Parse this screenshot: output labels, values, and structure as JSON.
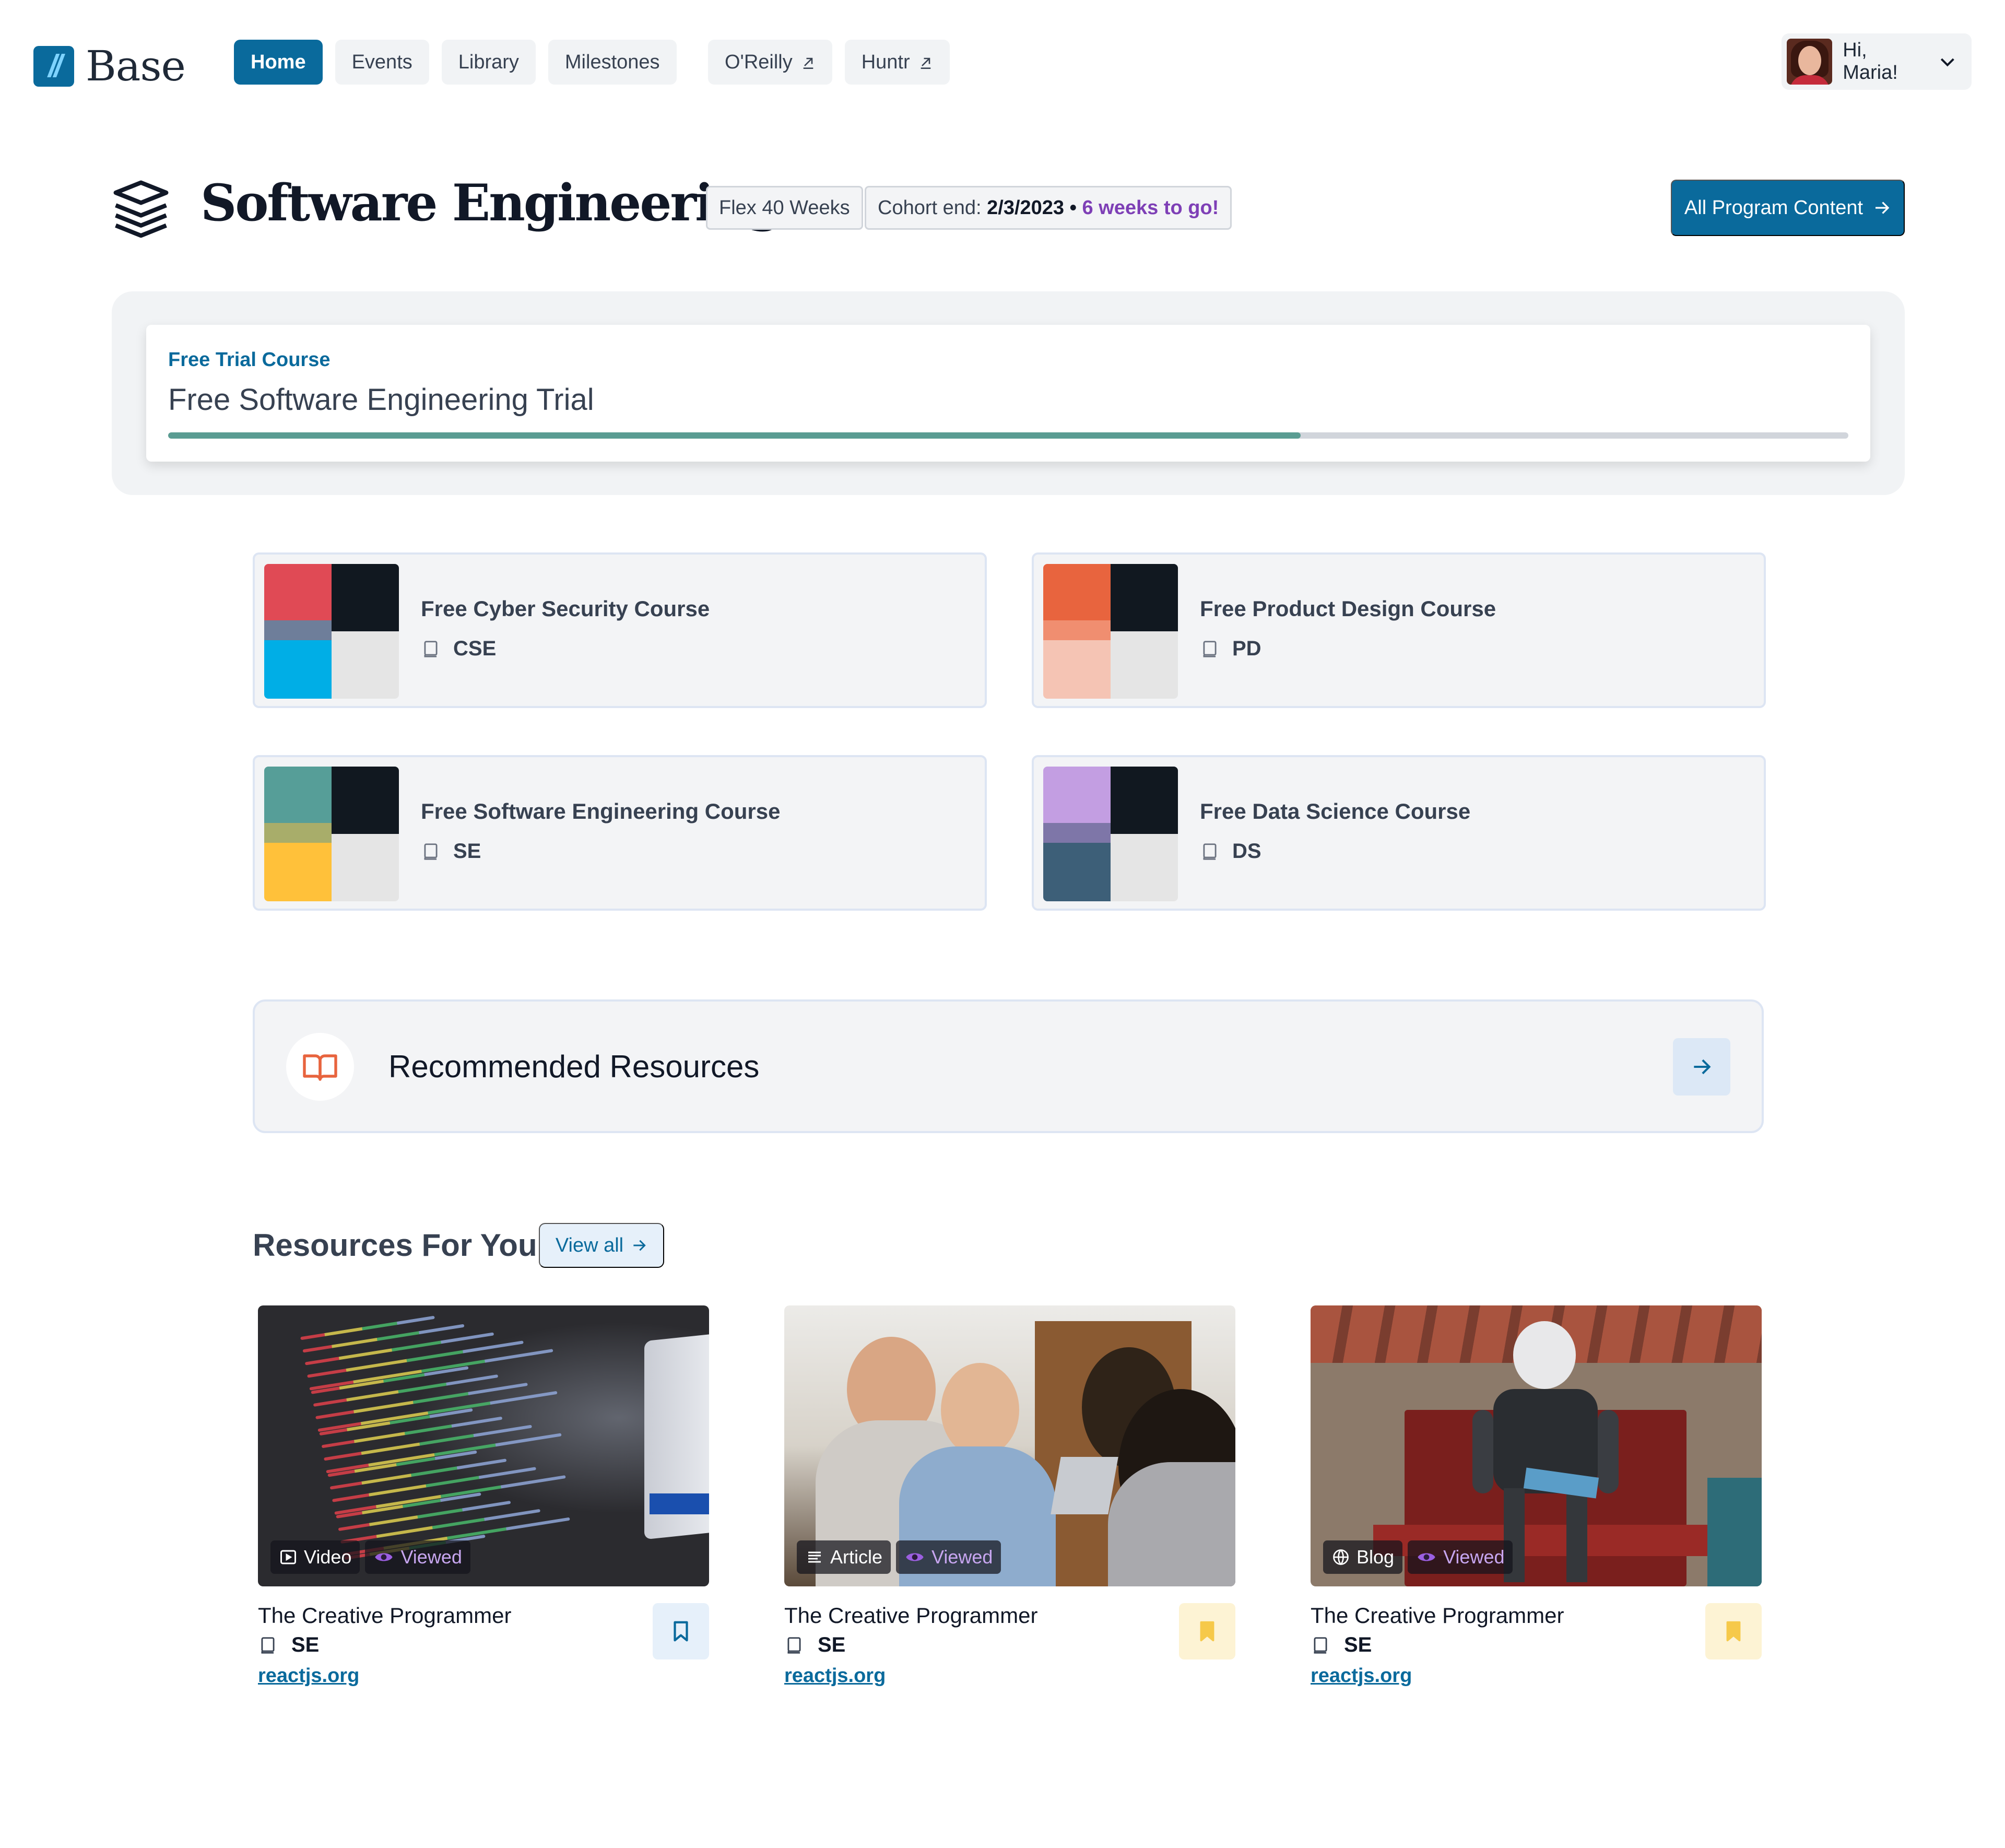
{
  "brand": {
    "logo_text": "Base",
    "accent": "#0a6a9c"
  },
  "nav": {
    "items": [
      {
        "label": "Home",
        "active": true
      },
      {
        "label": "Events",
        "active": false
      },
      {
        "label": "Library",
        "active": false
      },
      {
        "label": "Milestones",
        "active": false
      }
    ],
    "external": [
      {
        "label": "O'Reilly",
        "icon": "external-link-icon"
      },
      {
        "label": "Huntr",
        "icon": "external-link-icon"
      }
    ],
    "user": {
      "greeting": "Hi, Maria!",
      "icon": "chevron-down-icon"
    }
  },
  "header": {
    "title": "Software Engineering",
    "icon": "stack-layers-icon",
    "plan_tag": "Flex 40 Weeks",
    "cohort_prefix": "Cohort end: ",
    "cohort_date": "2/3/2023",
    "cohort_sep": " • ",
    "cohort_remaining": "6 weeks to go!",
    "all_content_label": "All Program Content"
  },
  "trial": {
    "kicker": "Free Trial Course",
    "title": "Free Software Engineering Trial",
    "progress": 0.674,
    "progress_color": "#5a9c92"
  },
  "courses": [
    {
      "title": "Free Cyber Security Course",
      "code": "CSE",
      "colors": [
        "#e04a55",
        "#111820",
        "#6e7e9a",
        "#00aee6",
        "#e5e5e5"
      ]
    },
    {
      "title": "Free Product Design Course",
      "code": "PD",
      "colors": [
        "#e8643e",
        "#111820",
        "#f08e70",
        "#f5c4b4",
        "#e5e5e5"
      ]
    },
    {
      "title": "Free Software Engineering Course",
      "code": "SE",
      "colors": [
        "#569e98",
        "#111820",
        "#a8ad6a",
        "#ffc13a",
        "#e5e5e5"
      ]
    },
    {
      "title": "Free Data Science Course",
      "code": "DS",
      "colors": [
        "#c39ee2",
        "#111820",
        "#7e76a8",
        "#3d5f78",
        "#e5e5e5"
      ]
    }
  ],
  "recommended": {
    "title": "Recommended Resources",
    "icon": "open-book-icon"
  },
  "resources": {
    "heading": "Resources For You",
    "view_all_label": "View all",
    "items": [
      {
        "type": "Video",
        "type_icon": "video-icon",
        "status": "Viewed",
        "title": "The Creative Programmer",
        "code": "SE",
        "link": "reactjs.org",
        "bookmarked": false,
        "image": "code-screen"
      },
      {
        "type": "Article",
        "type_icon": "article-lines-icon",
        "status": "Viewed",
        "title": "The Creative Programmer",
        "code": "SE",
        "link": "reactjs.org",
        "bookmarked": true,
        "image": "people-laptop"
      },
      {
        "type": "Blog",
        "type_icon": "globe-icon",
        "status": "Viewed",
        "title": "The Creative Programmer",
        "code": "SE",
        "link": "reactjs.org",
        "bookmarked": true,
        "image": "robot-bench"
      }
    ]
  }
}
